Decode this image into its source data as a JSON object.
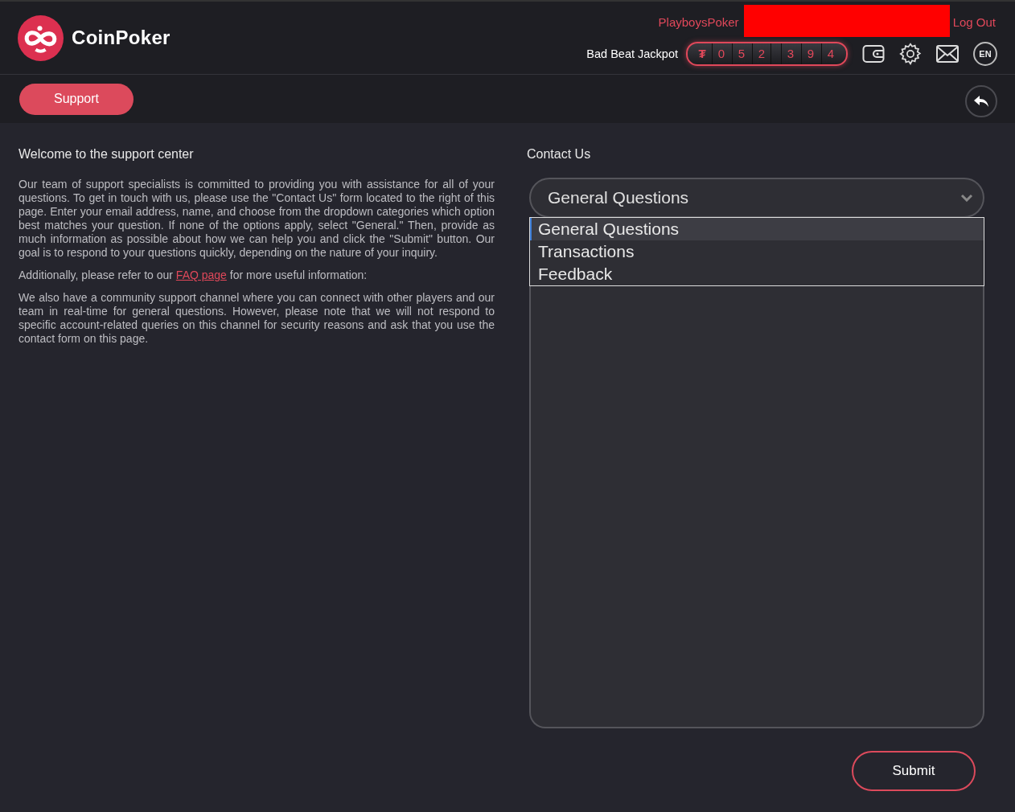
{
  "header": {
    "brand": "CoinPoker",
    "username": "PlayboysPoker",
    "logout": "Log Out",
    "jackpot": {
      "label": "Bad Beat Jackpot",
      "symbol": "₮",
      "groups": [
        [
          "0",
          "5",
          "2"
        ],
        [
          "3",
          "9",
          "4"
        ]
      ]
    },
    "language": "EN"
  },
  "toolbar": {
    "tab": "Support"
  },
  "info": {
    "title": "Welcome to the support center",
    "paragraph_1": "Our team of support specialists is committed to providing you with assistance for all of your questions. To get in touch with us, please use the \"Contact Us\" form located to the right of this page. Enter your email address, name, and choose from the dropdown categories which option best matches your question. If none of the options apply, select \"General.\" Then, provide as much information as possible about how we can help you and click the \"Submit\" button. Our goal is to respond to your questions quickly, depending on the nature of your inquiry.",
    "paragraph_2_before": "Additionally, please refer to our",
    "faq_link": "FAQ page",
    "paragraph_2_after": "for more useful information:",
    "paragraph_3": "We also have a community support channel where you can connect with other players and our team in real-time for general questions. However, please note that we will not respond to specific account-related queries on this channel for security reasons and ask that you use the contact form on this page."
  },
  "contact": {
    "title": "Contact Us",
    "category": {
      "value": "General Questions",
      "expanded": true,
      "options": [
        {
          "label": "General Questions",
          "selected": true
        },
        {
          "label": "Transactions",
          "selected": false
        },
        {
          "label": "Feedback",
          "selected": false
        }
      ]
    },
    "submit": "Submit"
  }
}
